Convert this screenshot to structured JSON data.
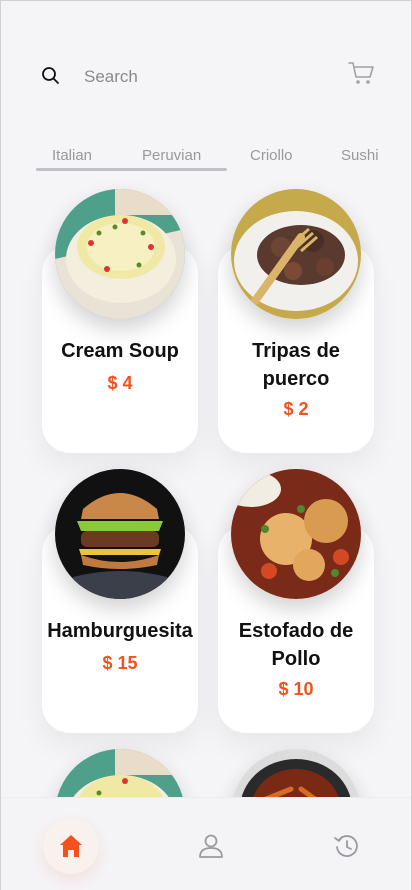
{
  "search": {
    "placeholder": "Search"
  },
  "header": {
    "cart_icon": "cart-icon",
    "search_icon": "search-icon"
  },
  "categories": {
    "tabs": [
      "Italian",
      "Peruvian",
      "Criollo",
      "Sushi"
    ],
    "active_indicator": "Italian / Peruvian"
  },
  "foods": [
    {
      "title": "Cream Soup",
      "price": "$ 4"
    },
    {
      "title": "Tripas de puerco",
      "price": "$ 2"
    },
    {
      "title": "Hamburguesita",
      "price": "$ 15"
    },
    {
      "title": "Estofado de Pollo",
      "price": "$ 10"
    }
  ],
  "bottom_nav": {
    "items": [
      "home-icon",
      "profile-icon",
      "history-icon"
    ],
    "active": "home-icon"
  },
  "colors": {
    "accent": "#f4511e",
    "background": "#f5f5f8",
    "card": "#ffffff",
    "muted_text": "#999999"
  }
}
